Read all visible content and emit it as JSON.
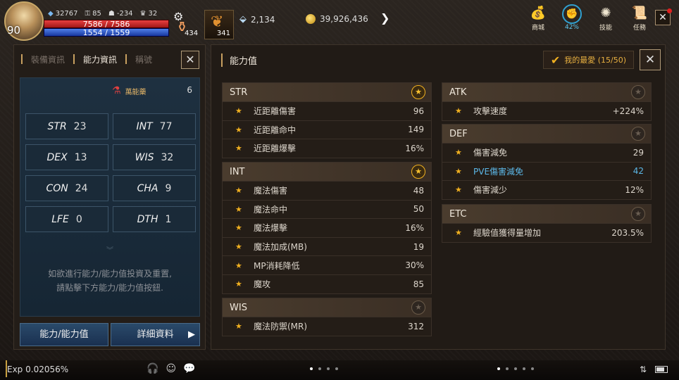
{
  "hud": {
    "level": "90",
    "gem_small": "32767",
    "stat_a": "85",
    "stat_b": "-234",
    "stat_c": "32",
    "hp_text": "7586 / 7586",
    "mp_text": "1554 / 1559",
    "potion_count": "434",
    "feather_count": "341",
    "gem_currency": "2,134",
    "gold_currency": "39,926,436",
    "progress_pct": "42%"
  },
  "top_menu": [
    {
      "label": "商城",
      "icon": "shop-bag-icon"
    },
    {
      "label": "42%",
      "icon": "progress-ring-icon"
    },
    {
      "label": "技能",
      "icon": "skill-icon"
    },
    {
      "label": "任務",
      "icon": "quest-scroll-icon"
    }
  ],
  "left_panel": {
    "tabs": [
      "裝備資訊",
      "能力資訊",
      "稱號"
    ],
    "bonus_label": "萬能藥",
    "bonus_count": "6",
    "stats": [
      {
        "name": "STR",
        "value": "23"
      },
      {
        "name": "INT",
        "value": "77"
      },
      {
        "name": "DEX",
        "value": "13"
      },
      {
        "name": "WIS",
        "value": "32"
      },
      {
        "name": "CON",
        "value": "24"
      },
      {
        "name": "CHA",
        "value": "9"
      },
      {
        "name": "LFE",
        "value": "0"
      },
      {
        "name": "DTH",
        "value": "1"
      }
    ],
    "hint_line1": "如欲進行能力/能力值投資及重置,",
    "hint_line2": "請點擊下方能力/能力值按鈕.",
    "btn_ability": "能力/能力值",
    "btn_detail": "詳細資料"
  },
  "right_panel": {
    "title": "能力值",
    "favorite": "我的最愛 (15/50)",
    "groups": {
      "str": {
        "name": "STR",
        "rows": [
          {
            "label": "近距離傷害",
            "value": "96"
          },
          {
            "label": "近距離命中",
            "value": "149"
          },
          {
            "label": "近距離爆擊",
            "value": "16%"
          }
        ]
      },
      "int": {
        "name": "INT",
        "rows": [
          {
            "label": "魔法傷害",
            "value": "48"
          },
          {
            "label": "魔法命中",
            "value": "50"
          },
          {
            "label": "魔法爆擊",
            "value": "16%"
          },
          {
            "label": "魔法加成(MB)",
            "value": "19"
          },
          {
            "label": "MP消耗降低",
            "value": "30%"
          },
          {
            "label": "魔攻",
            "value": "85"
          }
        ]
      },
      "wis": {
        "name": "WIS",
        "rows": [
          {
            "label": "魔法防禦(MR)",
            "value": "312"
          }
        ]
      },
      "atk": {
        "name": "ATK",
        "rows": [
          {
            "label": "攻擊速度",
            "value": "+224%"
          }
        ]
      },
      "def": {
        "name": "DEF",
        "rows": [
          {
            "label": "傷害減免",
            "value": "29"
          },
          {
            "label": "PVE傷害減免",
            "value": "42"
          },
          {
            "label": "傷害減少",
            "value": "12%"
          }
        ]
      },
      "etc": {
        "name": "ETC",
        "rows": [
          {
            "label": "經驗值獲得量增加",
            "value": "203.5%"
          }
        ]
      }
    }
  },
  "bottom": {
    "exp_label": "Exp",
    "exp_value": "0.02056%"
  },
  "colors": {
    "accent_gold": "#f0b020",
    "stat_blue_bg": "#1e3040",
    "highlight_blue": "#5cb8e8"
  }
}
